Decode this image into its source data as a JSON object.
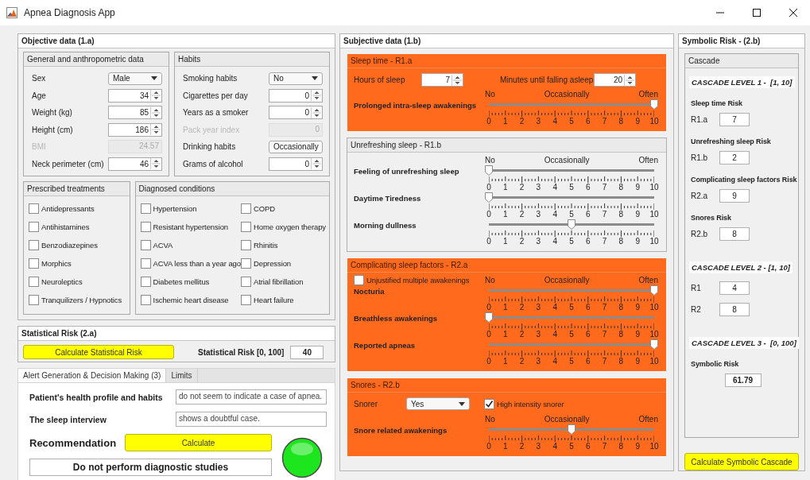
{
  "window": {
    "title": "Apnea Diagnosis App"
  },
  "objective": {
    "title": "Objective data (1.a)",
    "general": {
      "title": "General and anthropometric data",
      "fields": [
        {
          "kind": "dropdown",
          "label": "Sex",
          "value": "Male",
          "disabled": false
        },
        {
          "kind": "spinner",
          "label": "Age",
          "value": "34",
          "disabled": false
        },
        {
          "kind": "spinner",
          "label": "Weight (kg)",
          "value": "85",
          "disabled": false
        },
        {
          "kind": "spinner",
          "label": "Height (cm)",
          "value": "186",
          "disabled": false
        },
        {
          "kind": "number",
          "label": "BMI",
          "value": "24.57",
          "disabled": true
        },
        {
          "kind": "spinner",
          "label": "Neck perimeter (cm)",
          "value": "46",
          "disabled": false
        }
      ]
    },
    "habits": {
      "title": "Habits",
      "fields": [
        {
          "kind": "dropdown",
          "label": "Smoking habits",
          "value": "No",
          "disabled": false
        },
        {
          "kind": "spinner",
          "label": "Cigarettes per day",
          "value": "0",
          "disabled": false
        },
        {
          "kind": "spinner",
          "label": "Years as a smoker",
          "value": "0",
          "disabled": false
        },
        {
          "kind": "number",
          "label": "Pack year index",
          "value": "0",
          "disabled": true
        },
        {
          "kind": "dropdown",
          "label": "Drinking habits",
          "value": "Occasionally",
          "disabled": false
        },
        {
          "kind": "spinner",
          "label": "Grams of alcohol",
          "value": "0",
          "disabled": false
        }
      ]
    },
    "treatments": {
      "title": "Prescribed treatments",
      "items": [
        {
          "label": "Antidepressants",
          "checked": false
        },
        {
          "label": "Antihistamines",
          "checked": false
        },
        {
          "label": "Benzodiazepines",
          "checked": false
        },
        {
          "label": "Morphics",
          "checked": false
        },
        {
          "label": "Neuroleptics",
          "checked": false
        },
        {
          "label": "Tranquilizers / Hypnotics",
          "checked": false
        }
      ]
    },
    "conditions": {
      "title": "Diagnosed conditions",
      "items": [
        {
          "label": "Hypertension",
          "checked": false
        },
        {
          "label": "COPD",
          "checked": false
        },
        {
          "label": "Resistant hypertension",
          "checked": false
        },
        {
          "label": "Home oxygen therapy",
          "checked": false
        },
        {
          "label": "ACVA",
          "checked": false
        },
        {
          "label": "Rhinitis",
          "checked": false
        },
        {
          "label": "ACVA less than a year ago",
          "checked": false
        },
        {
          "label": "Depression",
          "checked": false
        },
        {
          "label": "Diabetes mellitus",
          "checked": false
        },
        {
          "label": "Atrial fibrillation",
          "checked": false
        },
        {
          "label": "Ischemic heart disease",
          "checked": false
        },
        {
          "label": "Heart failure",
          "checked": false
        }
      ]
    }
  },
  "statistical": {
    "title": "Statistical Risk (2.a)",
    "button": "Calculate Statistical Risk",
    "label": "Statistical Risk [0, 100]",
    "value": "40"
  },
  "decision": {
    "tabs": [
      {
        "label": "Alert Generation & Decision Making (3)",
        "selected": true
      },
      {
        "label": "Limits",
        "selected": false
      }
    ],
    "findings": [
      {
        "label": "Patient's health profile and habits",
        "value": "do not seem to indicate a case of apnea."
      },
      {
        "label": "The sleep interview",
        "value": "shows a doubtful case."
      }
    ],
    "recommendation": {
      "label": "Recommendation",
      "button": "Calculate",
      "result": "Do not perform diagnostic studies",
      "light": {
        "color": "#1ee61e"
      }
    }
  },
  "subjective": {
    "title": "Subjective data (1.b)",
    "groups": [
      {
        "title": "Sleep time - R1.a",
        "highlighted": true,
        "inputs": [
          {
            "kind": "spinner",
            "label": "Hours of sleep",
            "value": "7"
          },
          {
            "kind": "spinner",
            "label": "Minutes until falling asleep",
            "value": "20"
          }
        ],
        "scale": [
          "No",
          "Occasionally",
          "Often"
        ],
        "sliders": [
          {
            "label": "Prolonged intra-sleep awakenings",
            "level": 1,
            "ticks": [
              "0",
              "1",
              "2",
              "3",
              "4",
              "5",
              "6",
              "7",
              "8",
              "9",
              "10"
            ]
          }
        ]
      },
      {
        "title": "Unrefreshing sleep - R1.b",
        "highlighted": false,
        "scale": [
          "No",
          "Occasionally",
          "Often"
        ],
        "sliders": [
          {
            "label": "Feeling of unrefreshing sleep",
            "level": 0,
            "ticks": [
              "0",
              "1",
              "2",
              "3",
              "4",
              "5",
              "6",
              "7",
              "8",
              "9",
              "10"
            ]
          },
          {
            "label": "Daytime Tiredness",
            "level": 0,
            "ticks": [
              "0",
              "1",
              "2",
              "3",
              "4",
              "5",
              "6",
              "7",
              "8",
              "9",
              "10"
            ]
          },
          {
            "label": "Morning dullness",
            "level": 0.5,
            "ticks": [
              "0",
              "1",
              "2",
              "3",
              "4",
              "5",
              "6",
              "7",
              "8",
              "9",
              "10"
            ]
          }
        ]
      },
      {
        "title": "Complicating sleep factors - R2.a",
        "highlighted": true,
        "scale_side": [
          {
            "kind": "checkbox",
            "label": "Unjustified multiple awakenings",
            "checked": false
          }
        ],
        "scale": [
          "No",
          "Occasionally",
          "Often"
        ],
        "sliders": [
          {
            "label": "Nocturia",
            "level": 1,
            "ticks": [
              "0",
              "1",
              "2",
              "3",
              "4",
              "5",
              "6",
              "7",
              "8",
              "9",
              "10"
            ]
          },
          {
            "label": "Breathless awakenings",
            "level": 0,
            "ticks": [
              "0",
              "1",
              "2",
              "3",
              "4",
              "5",
              "6",
              "7",
              "8",
              "9",
              "10"
            ]
          },
          {
            "label": "Reported apneas",
            "level": 1,
            "ticks": [
              "0",
              "1",
              "2",
              "3",
              "4",
              "5",
              "6",
              "7",
              "8",
              "9",
              "10"
            ]
          }
        ]
      },
      {
        "title": "Snores - R2.b",
        "highlighted": true,
        "inputs": [
          {
            "kind": "dropdown",
            "label": "Snorer",
            "value": "Yes"
          },
          {
            "kind": "checkbox",
            "label": "High intensity snorer",
            "checked": true
          }
        ],
        "scale": [
          "No",
          "Occasionally",
          "Often"
        ],
        "sliders": [
          {
            "label": "Snore related awakenings",
            "level": 0.5,
            "ticks": [
              "0",
              "1",
              "2",
              "3",
              "4",
              "5",
              "6",
              "7",
              "8",
              "9",
              "10"
            ]
          }
        ]
      }
    ]
  },
  "symbolic": {
    "title": "Symbolic Risk - (2.b)",
    "cascade_title": "Cascade",
    "levels": [
      {
        "heading": "CASCADE LEVEL 1 -  [1, 10]",
        "items": [
          {
            "kind": "score",
            "title": "Sleep time Risk",
            "label": "R1.a",
            "value": "7"
          },
          {
            "kind": "score",
            "title": "Unrefreshing sleep Risk",
            "label": "R1.b",
            "value": "2"
          },
          {
            "kind": "score",
            "title": "Complicating sleep factors Risk",
            "label": "R2.a",
            "value": "9"
          },
          {
            "kind": "score",
            "title": "Snores Risk",
            "label": "R2.b",
            "value": "8"
          }
        ]
      },
      {
        "heading": "CASCADE LEVEL 2 - [1, 10]",
        "items": [
          {
            "kind": "score",
            "label": "R1",
            "value": "4"
          },
          {
            "kind": "score",
            "label": "R2",
            "value": "8"
          }
        ]
      },
      {
        "heading": "CASCADE LEVEL 3 -  [0, 100]",
        "items": [
          {
            "kind": "total",
            "title": "Symbolic Risk",
            "value": "61.79"
          }
        ]
      }
    ],
    "button": "Calculate Symbolic Cascade"
  }
}
